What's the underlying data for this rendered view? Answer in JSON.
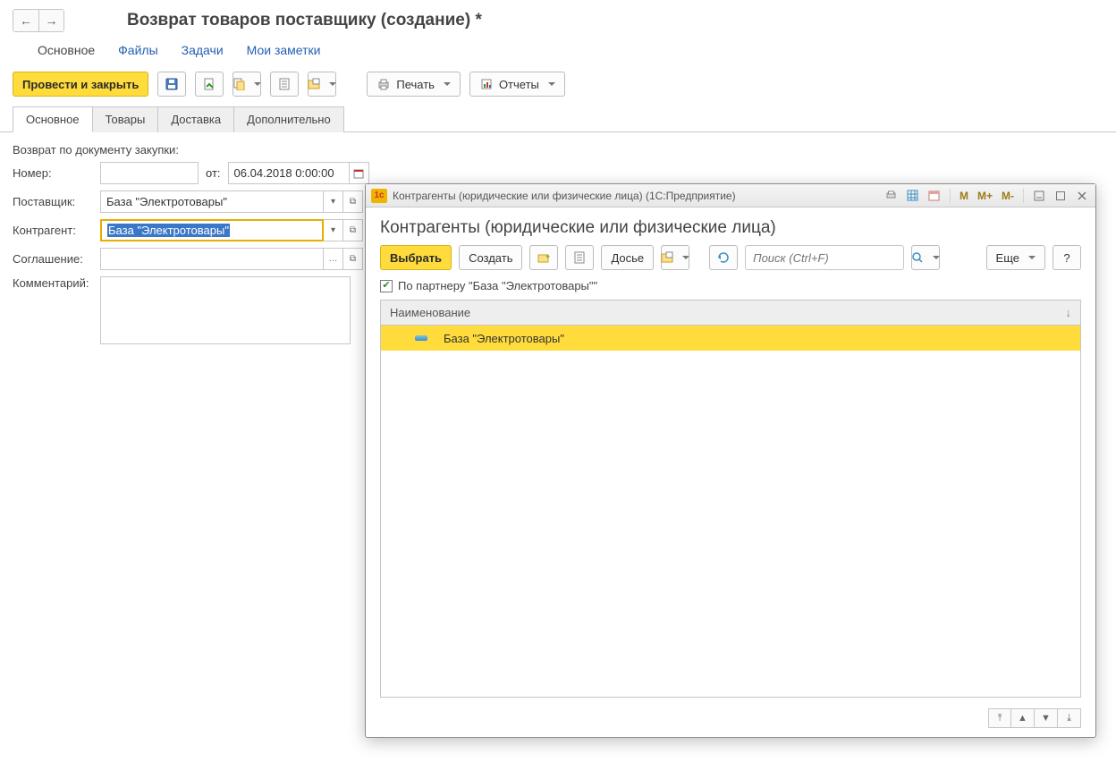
{
  "header": {
    "title": "Возврат товаров поставщику (создание) *"
  },
  "nav": {
    "items": [
      "Основное",
      "Файлы",
      "Задачи",
      "Мои заметки"
    ],
    "active_index": 0
  },
  "toolbar": {
    "post_and_close": "Провести и закрыть",
    "print": "Печать",
    "reports": "Отчеты"
  },
  "tabs": {
    "items": [
      "Основное",
      "Товары",
      "Доставка",
      "Дополнительно"
    ],
    "active_index": 0
  },
  "form": {
    "return_by_doc_label": "Возврат по документу закупки:",
    "number_label": "Номер:",
    "number_value": "",
    "from_label": "от:",
    "date_value": "06.04.2018  0:00:00",
    "supplier_label": "Поставщик:",
    "supplier_value": "База \"Электротовары\"",
    "contragent_label": "Контрагент:",
    "contragent_value": "База \"Электротовары\"",
    "agreement_label": "Соглашение:",
    "agreement_value": "",
    "comment_label": "Комментарий:",
    "comment_value": ""
  },
  "modal": {
    "titlebar": "Контрагенты (юридические или физические лица)  (1С:Предприятие)",
    "calc_btns": [
      "M",
      "M+",
      "M-"
    ],
    "header": "Контрагенты (юридические или физические лица)",
    "btn_select": "Выбрать",
    "btn_create": "Создать",
    "btn_dossier": "Досье",
    "btn_more": "Еще",
    "btn_help": "?",
    "search_placeholder": "Поиск (Ctrl+F)",
    "filter_label": "По партнеру \"База \"Электротовары\"\"",
    "filter_checked": true,
    "grid_header": "Наименование",
    "sort_indicator": "↓",
    "rows": [
      {
        "name": "База \"Электротовары\"",
        "selected": true
      }
    ]
  }
}
